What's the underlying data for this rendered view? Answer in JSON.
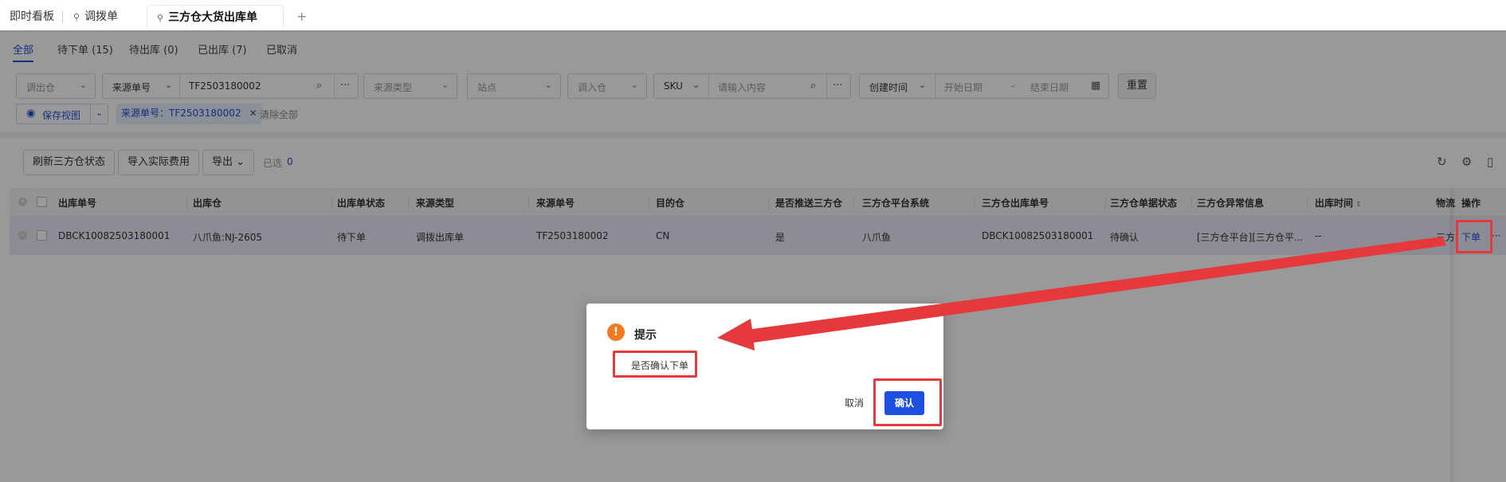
{
  "tabs": {
    "items": [
      "即时看板",
      "调拨单",
      "三方仓大货出库单"
    ],
    "add_symbol": "+"
  },
  "status_tabs": [
    "全部",
    "待下单 (15)",
    "待出库 (0)",
    "已出库 (7)",
    "已取消"
  ],
  "filters": {
    "out_warehouse": "调出仓",
    "source_no_type": "来源单号",
    "source_no_value": "TF2503180002",
    "source_type": "来源类型",
    "site": "站点",
    "in_warehouse": "调入仓",
    "sku_type": "SKU",
    "sku_placeholder": "请输入内容",
    "time_type": "创建时间",
    "start_date": "开始日期",
    "date_sep": "-",
    "end_date": "结束日期",
    "reset": "重置",
    "save_view": "保存视图",
    "active_chip": "来源单号：TF2503180002",
    "clear_all": "清除全部"
  },
  "toolbar": {
    "refresh": "刷新三方仓状态",
    "import_fee": "导入实际费用",
    "export": "导出",
    "selected_label": "已选",
    "selected_count": "0"
  },
  "table": {
    "headers": [
      "出库单号",
      "出库仓",
      "出库单状态",
      "来源类型",
      "来源单号",
      "目的仓",
      "是否推送三方仓",
      "三方仓平台系统",
      "三方仓出库单号",
      "三方仓单据状态",
      "三方仓异常信息",
      "出库时间",
      "物流",
      "操作"
    ],
    "row": {
      "out_no": "DBCK10082503180001",
      "warehouse": "八爪鱼:NJ-2605",
      "status": "待下单",
      "source_type": "调拨出库单",
      "source_no": "TF2503180002",
      "dest": "CN",
      "pushed": "是",
      "platform": "八爪鱼",
      "third_no": "DBCK10082503180001",
      "third_status": "待确认",
      "error": "[三方仓平台][三方仓平...",
      "out_time": "--",
      "logistics": "三方",
      "action": "下单",
      "more": "···"
    }
  },
  "dialog": {
    "title": "提示",
    "message": "是否确认下单",
    "cancel": "取消",
    "confirm": "确认"
  },
  "colors": {
    "primary": "#1d4fe0",
    "warning": "#f07a22",
    "annotation": "#e5393b"
  }
}
